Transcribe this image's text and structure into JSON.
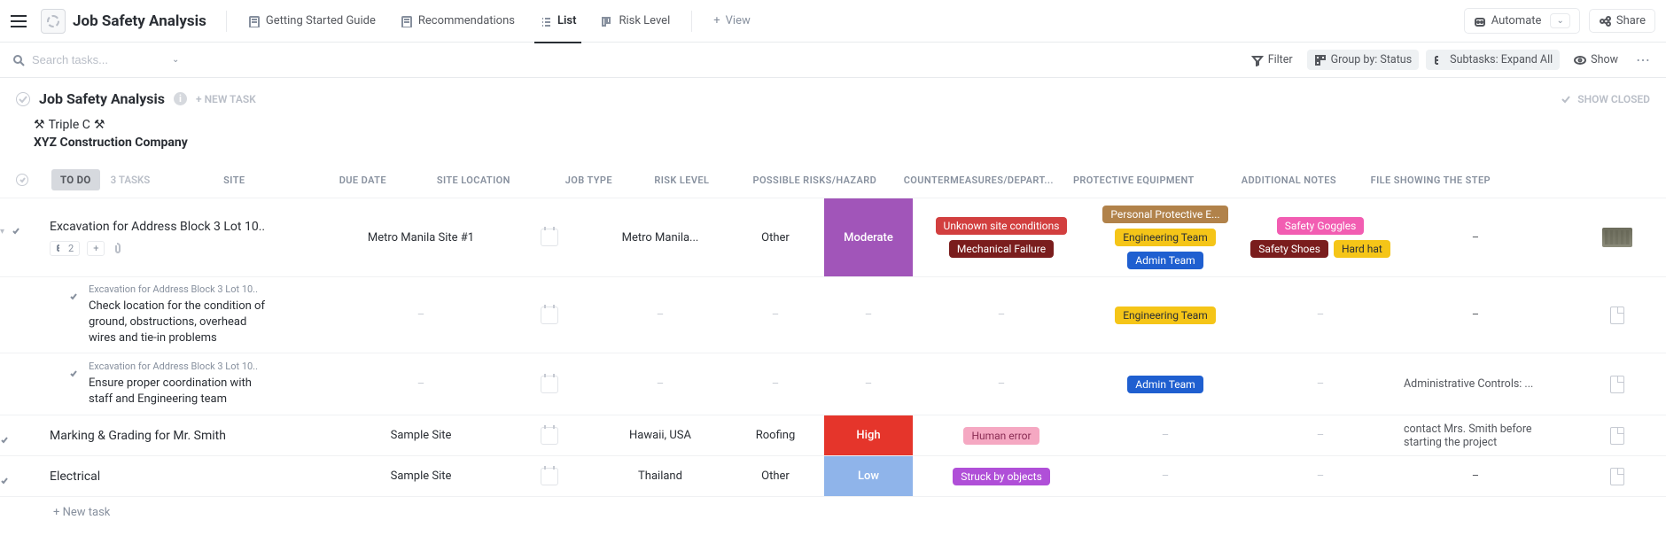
{
  "header": {
    "title": "Job Safety Analysis",
    "views": [
      {
        "label": "Getting Started Guide",
        "icon": "doc"
      },
      {
        "label": "Recommendations",
        "icon": "doc"
      },
      {
        "label": "List",
        "icon": "list",
        "active": true
      },
      {
        "label": "Risk Level",
        "icon": "board"
      }
    ],
    "add_view": "View",
    "automate": "Automate",
    "share": "Share"
  },
  "toolbar": {
    "search_placeholder": "Search tasks...",
    "filter": "Filter",
    "group_by": "Group by: Status",
    "subtasks": "Subtasks: Expand All",
    "show": "Show"
  },
  "list": {
    "title": "Job Safety Analysis",
    "new_task": "+ NEW TASK",
    "show_closed": "SHOW CLOSED",
    "subtitle_line1": "Triple C",
    "subtitle_company": "XYZ Construction Company"
  },
  "group": {
    "status": "TO DO",
    "count": "3 TASKS",
    "columns": {
      "site": "SITE",
      "due": "DUE DATE",
      "loc": "SITE LOCATION",
      "type": "JOB TYPE",
      "risk": "RISK LEVEL",
      "hazard": "POSSIBLE RISKS/HAZARD",
      "dept": "COUNTERMEASURES/DEPART...",
      "ppe": "PROTECTIVE EQUIPMENT",
      "notes": "ADDITIONAL NOTES",
      "file": "FILE SHOWING THE STEP"
    }
  },
  "tasks": [
    {
      "name": "Excavation for Address Block 3 Lot 10..",
      "subcount": "2",
      "site": "Metro Manila Site #1",
      "loc": "Metro Manila...",
      "type": "Other",
      "risk": {
        "label": "Moderate",
        "class": "risk-mod"
      },
      "hazards": [
        {
          "text": "Unknown site conditions",
          "bg": "#d23f3f"
        },
        {
          "text": "Mechanical Failure",
          "bg": "#7a1d1d"
        }
      ],
      "depts": [
        {
          "text": "Personal Protective E...",
          "bg": "#b1824a"
        },
        {
          "text": "Engineering Team",
          "bg": "#f5c518",
          "fg": "#2a2e34"
        },
        {
          "text": "Admin Team",
          "bg": "#1f5fd0"
        }
      ],
      "ppe": [
        {
          "text": "Safety Goggles",
          "bg": "#f25db2"
        },
        {
          "text": "Safety Shoes",
          "bg": "#7a1d1d"
        },
        {
          "text": "Hard hat",
          "bg": "#f5c518",
          "fg": "#2a2e34"
        }
      ],
      "note": "–",
      "file": "thumb"
    }
  ],
  "subtasks": [
    {
      "parent": "Excavation for Address Block 3 Lot 10..",
      "name": "Check location for the condition of ground, obstructions, overhead wires and tie-in problems",
      "depts": [
        {
          "text": "Engineering Team",
          "bg": "#f5c518",
          "fg": "#2a2e34"
        }
      ],
      "note": "–"
    },
    {
      "parent": "Excavation for Address Block 3 Lot 10..",
      "name": "Ensure proper coordination with staff and Engineering team",
      "depts": [
        {
          "text": "Admin Team",
          "bg": "#1f5fd0"
        }
      ],
      "note": "Administrative Controls: ..."
    }
  ],
  "tasks2": [
    {
      "name": "Marking & Grading for Mr. Smith",
      "site": "Sample Site",
      "loc": "Hawaii, USA",
      "type": "Roofing",
      "risk": {
        "label": "High",
        "class": "risk-high"
      },
      "hazards": [
        {
          "text": "Human error",
          "bg": "#f5a8c2",
          "fg": "#8a2c54"
        }
      ],
      "note": "contact Mrs. Smith before starting the project"
    },
    {
      "name": "Electrical",
      "site": "Sample Site",
      "loc": "Thailand",
      "type": "Other",
      "risk": {
        "label": "Low",
        "class": "risk-low"
      },
      "hazards": [
        {
          "text": "Struck by objects",
          "bg": "#b04fd8"
        }
      ],
      "note": "–"
    }
  ],
  "add_task": "+ New task"
}
